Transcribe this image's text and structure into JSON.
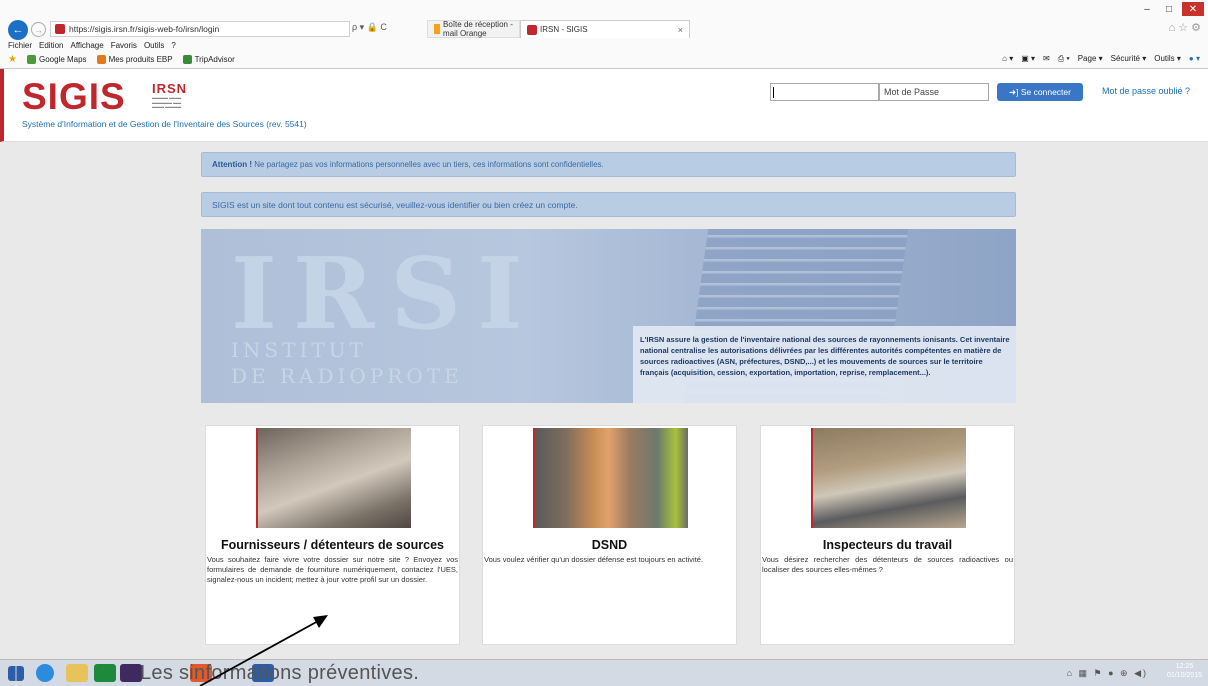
{
  "browser": {
    "url": "https://sigis.irsn.fr/sigis-web-fo/irsn/login",
    "addr_tools": "ρ ▾ 🔒 C",
    "tabs": [
      {
        "label": "Boîte de réception - mail Orange"
      },
      {
        "label": "IRSN - SIGIS",
        "close": "×"
      }
    ],
    "menu": [
      "Fichier",
      "Edition",
      "Affichage",
      "Favoris",
      "Outils",
      "?"
    ],
    "favorites": [
      "Google Maps",
      "Mes produits EBP",
      "TripAdvisor"
    ],
    "commands": [
      "Page ▾",
      "Sécurité ▾",
      "Outils ▾"
    ],
    "window_controls": [
      "–",
      "□",
      "✕"
    ]
  },
  "header": {
    "logo": "SIGIS",
    "irsn_logo": "IRSN",
    "subtitle": "Système d'Information et de Gestion de l'Inventaire des Sources (rev. 5541)",
    "login": {
      "username_value": "",
      "password_placeholder": "Mot de Passe",
      "connect_label": "➜] Se connecter",
      "forgot_label": "Mot de passe oublié ?"
    }
  },
  "alerts": {
    "attention_label": "Attention !",
    "attention_text": " Ne partagez pas vos informations personnelles avec un tiers, ces informations sont confidentielles.",
    "secure_text": "SIGIS est un site dont tout contenu est sécurisé, veuillez-vous identifier ou bien créez un compte."
  },
  "banner": {
    "big_letters": "IRSI",
    "institute_line1": "INSTITUT",
    "institute_line2": "DE RADIOPROTE",
    "text": "L'IRSN assure la gestion de l'inventaire national des sources de rayonnements ionisants. Cet inventaire national centralise les autorisations délivrées par les différentes autorités compétentes en matière de sources radioactives (ASN, préfectures, DSND,...) et les mouvements de sources sur le territoire français (acquisition, cession, exportation, importation, reprise, remplacement...)."
  },
  "cards": [
    {
      "title": "Fournisseurs / détenteurs de sources",
      "description": "Vous souhaitez faire vivre votre dossier sur notre site ? Envoyez vos formulaires de demande de fourniture numériquement, contactez l'UES, signalez-nous un incident; mettez à jour votre profil sur un dossier."
    },
    {
      "title": "DSND",
      "description": "Vous voulez vérifier qu'un dossier défense est toujours en activité."
    },
    {
      "title": "Inspecteurs du travail",
      "description": "Vous désirez rechercher des détenteurs de sources radioactives ou localiser des sources elles-mêmes ?"
    }
  ],
  "taskbar": {
    "overlay_text": "Les sinformations préventives.",
    "clock_time": "12:25",
    "clock_date": "01/10/2015"
  },
  "colors": {
    "brand_red": "#c0272d",
    "link_blue": "#1c6fb8",
    "button_blue": "#3a76c6",
    "alert_bg": "#b8cce4"
  }
}
